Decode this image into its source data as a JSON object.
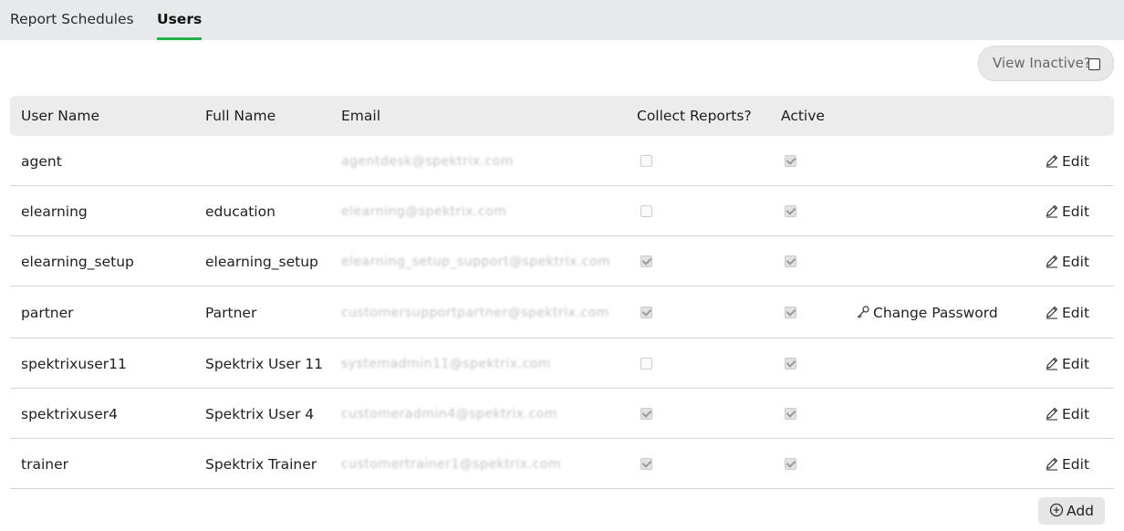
{
  "tabs": [
    {
      "label": "Report Schedules"
    },
    {
      "label": "Users"
    }
  ],
  "view_inactive": {
    "label": "View Inactive?",
    "checked": false
  },
  "table": {
    "headers": [
      "User Name",
      "Full Name",
      "Email",
      "Collect Reports?",
      "Active"
    ],
    "rows": [
      {
        "username": "agent",
        "fullname": "",
        "email": "agentdesk@spektrix.com",
        "collect": false,
        "active": true,
        "change_password": "",
        "edit": "Edit"
      },
      {
        "username": "elearning",
        "fullname": "education",
        "email": "elearning@spektrix.com",
        "collect": false,
        "active": true,
        "change_password": "",
        "edit": "Edit"
      },
      {
        "username": "elearning_setup",
        "fullname": "elearning_setup",
        "email": "elearning_setup_support@spektrix.com",
        "collect": true,
        "active": true,
        "change_password": "",
        "edit": "Edit"
      },
      {
        "username": "partner",
        "fullname": "Partner",
        "email": "customersupportpartner@spektrix.com",
        "collect": true,
        "active": true,
        "change_password": "Change Password",
        "edit": "Edit"
      },
      {
        "username": "spektrixuser11",
        "fullname": "Spektrix User 11",
        "email": "systemadmin11@spektrix.com",
        "collect": false,
        "active": true,
        "change_password": "",
        "edit": "Edit"
      },
      {
        "username": "spektrixuser4",
        "fullname": "Spektrix User 4",
        "email": "customeradmin4@spektrix.com",
        "collect": true,
        "active": true,
        "change_password": "",
        "edit": "Edit"
      },
      {
        "username": "trainer",
        "fullname": "Spektrix Trainer",
        "email": "customertrainer1@spektrix.com",
        "collect": true,
        "active": true,
        "change_password": "",
        "edit": "Edit"
      }
    ]
  },
  "add_button": {
    "label": "Add"
  }
}
